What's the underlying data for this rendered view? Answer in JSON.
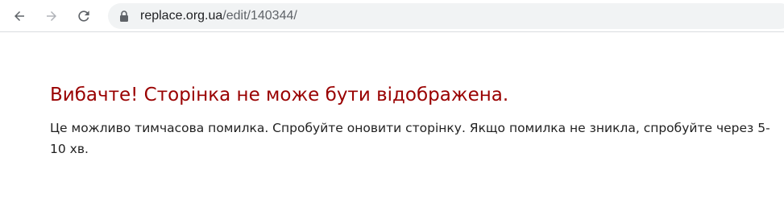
{
  "browser": {
    "url_host": "replace.org.ua",
    "url_path": "/edit/140344/",
    "icons": {
      "back": "arrow-left-icon",
      "forward": "arrow-right-icon",
      "reload": "reload-icon",
      "secure": "lock-icon"
    }
  },
  "error": {
    "title": "Вибачте! Сторінка не може бути відображена.",
    "message": "Це можливо тимчасова помилка. Спробуйте оновити сторінку. Якщо помилка не зникла, спробуйте через 5-10 хв.",
    "title_color": "#990000"
  }
}
